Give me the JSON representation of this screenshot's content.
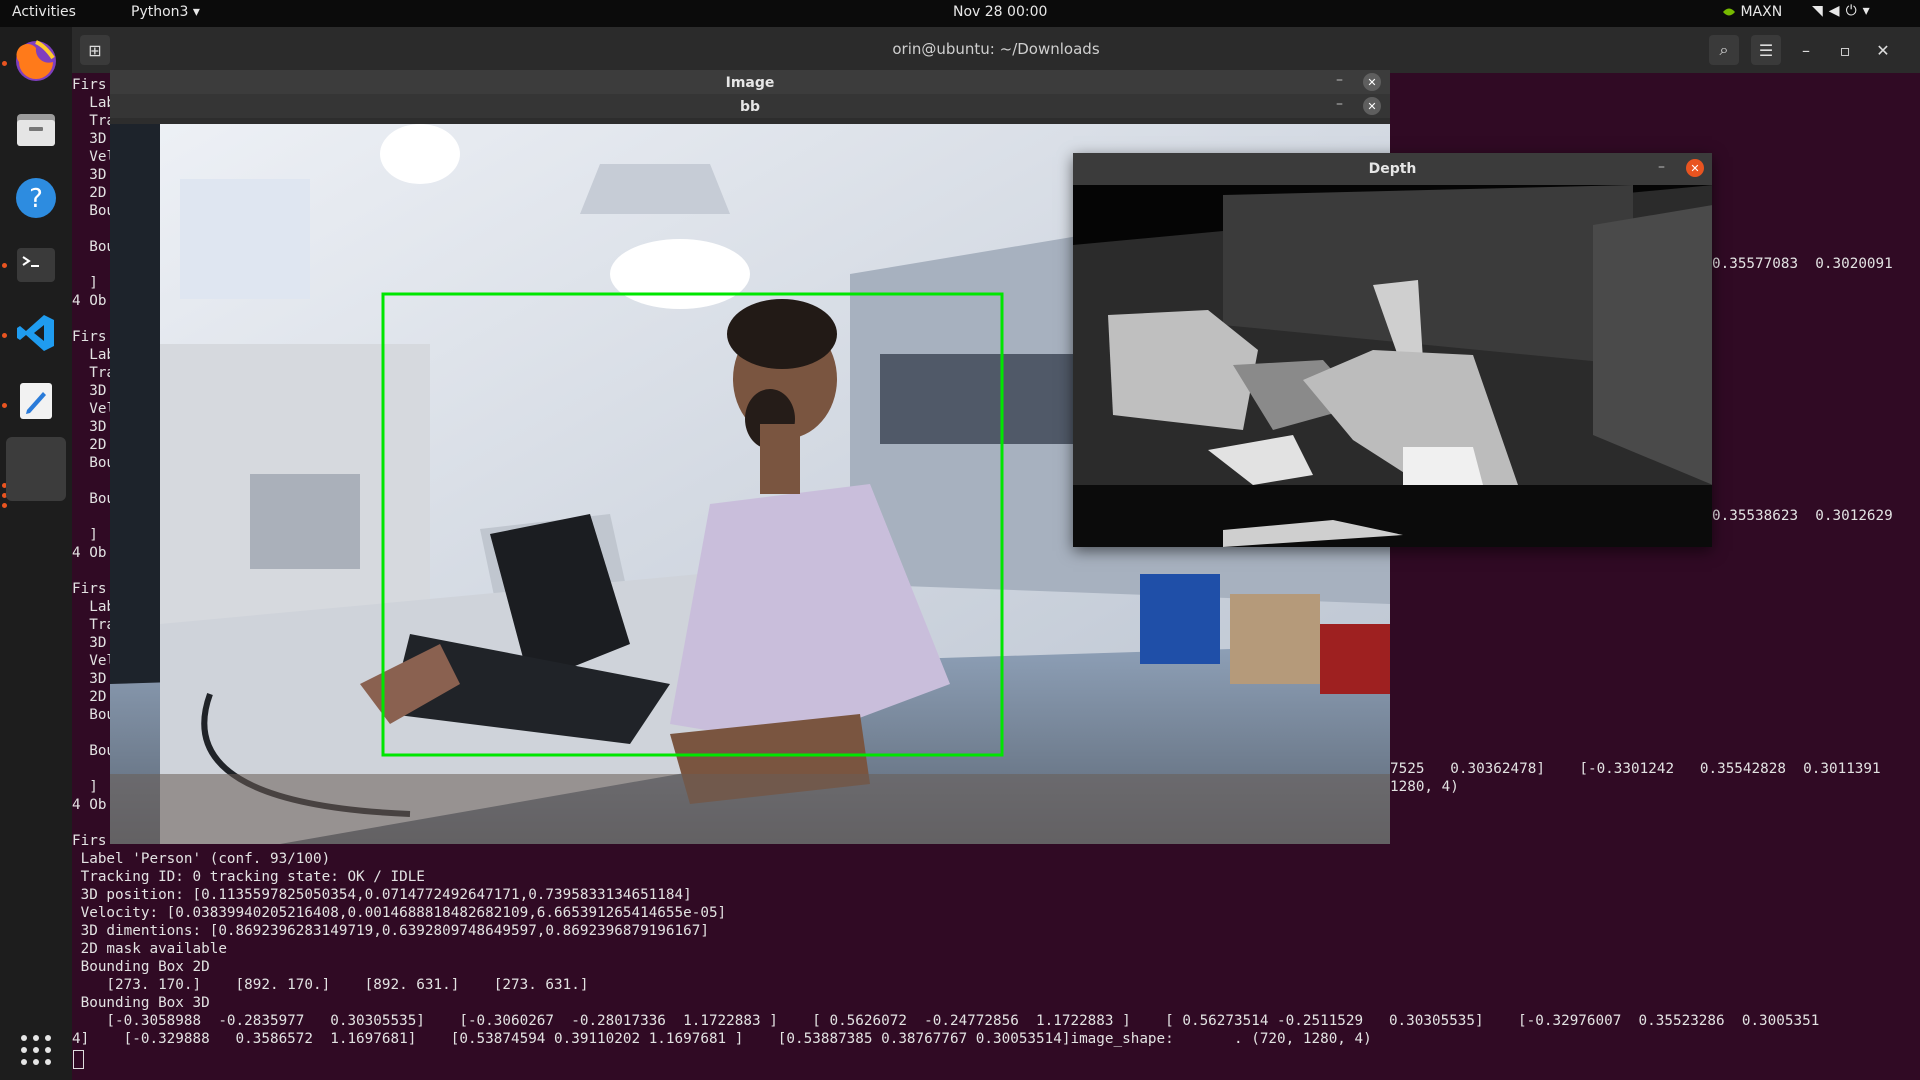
{
  "topbar": {
    "activities": "Activities",
    "app_menu": "Python3 ▾",
    "clock": "Nov 28  00:00",
    "power_mode": "MAXN"
  },
  "terminal": {
    "title": "orin@ubuntu: ~/Downloads",
    "left_col": [
      "Firs",
      "  Lab",
      "  Tra",
      "  3D",
      "  Vel",
      "  3D",
      "  2D",
      "  Bou",
      "",
      "  Bou",
      "",
      "  ]",
      "4 Ob",
      "",
      "Firs",
      "  Lab",
      "  Tra",
      "  3D",
      "  Vel",
      "  3D",
      "  2D",
      "  Bou",
      "",
      "  Bou",
      "",
      "  ]",
      "4 Ob",
      "",
      "Firs",
      "  Lab",
      "  Tra",
      "  3D",
      "  Vel",
      "  3D",
      "  2D",
      "  Bou",
      "",
      "  Bou",
      "",
      "  ]",
      "4 Ob",
      "",
      "Firs"
    ],
    "right_line_1": "0.35577083  0.3020091",
    "right_line_2": "0.35538623  0.3012629",
    "right_line_3": "7525   0.30362478]    [-0.3301242   0.35542828  0.3011391",
    "right_line_4": "1280, 4)",
    "bottom_lines": [
      " Label 'Person' (conf. 93/100)",
      " Tracking ID: 0 tracking state: OK / IDLE",
      " 3D position: [0.1135597825050354,0.0714772492647171,0.7395833134651184]",
      " Velocity: [0.03839940205216408,0.0014688818482682109,6.665391265414655e-05]",
      " 3D dimentions: [0.8692396283149719,0.6392809748649597,0.8692396879196167]",
      " 2D mask available",
      " Bounding Box 2D",
      "    [273. 170.]    [892. 170.]    [892. 631.]    [273. 631.]",
      " Bounding Box 3D",
      "    [-0.3058988  -0.2835977   0.30305535]    [-0.3060267  -0.28017336  1.1722883 ]    [ 0.5626072  -0.24772856  1.1722883 ]    [ 0.56273514 -0.2511529   0.30305535]    [-0.32976007  0.35523286  0.3005351",
      "4]    [-0.329888   0.3586572  1.1697681]    [0.53874594 0.39110202 1.1697681 ]    [0.53887385 0.38767767 0.30053514]image_shape:       . (720, 1280, 4)"
    ]
  },
  "image_window": {
    "title": "Image"
  },
  "bb_window": {
    "title": "bb"
  },
  "depth_window": {
    "title": "Depth"
  }
}
